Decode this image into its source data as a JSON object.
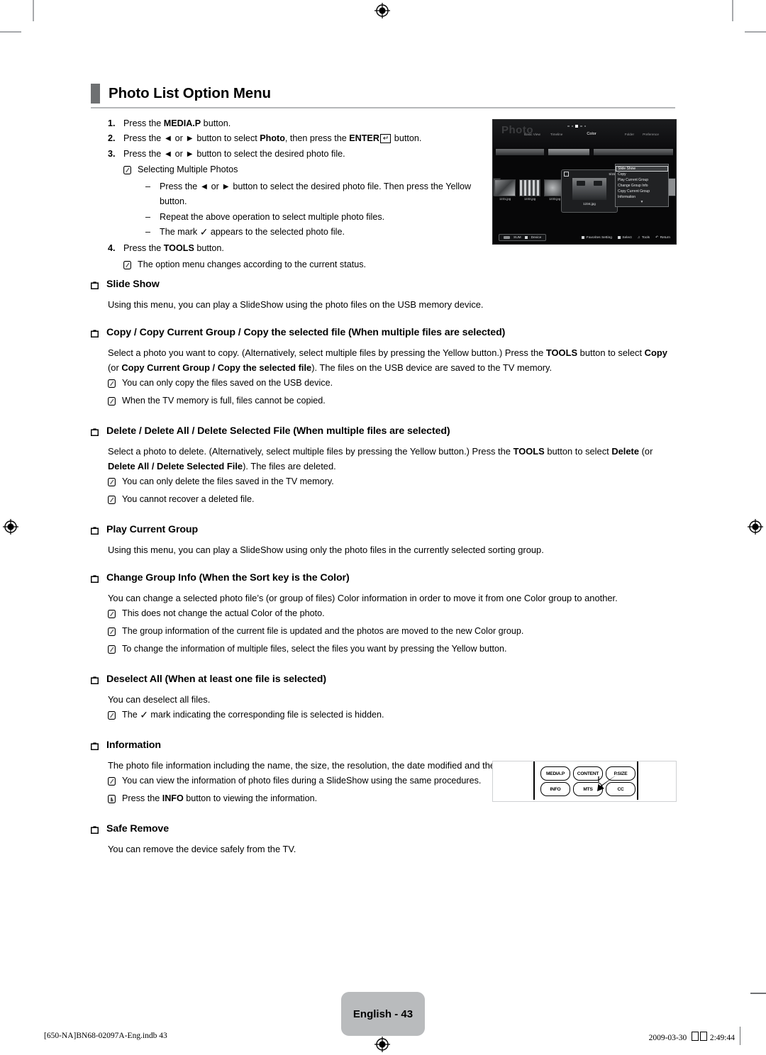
{
  "document": {
    "section_title": "Photo List Option Menu",
    "page_badge": "English - 43",
    "footer_left": "[650-NA]BN68-02097A-Eng.indb   43",
    "footer_date": "2009-03-30",
    "footer_time": "2:49:44"
  },
  "steps": [
    {
      "num": "1.",
      "pre": "Press the ",
      "bold": "MEDIA.P",
      "post": " button."
    },
    {
      "num": "2.",
      "pre": "Press the ◄ or ► button to select ",
      "bold": "Photo",
      "mid": ", then press the ",
      "bold2": "ENTER",
      "post": " button."
    },
    {
      "num": "3.",
      "pre": "Press the ◄ or ► button to select the desired photo file."
    },
    {
      "num": "4.",
      "pre": "Press the ",
      "bold": "TOOLS",
      "post": " button."
    }
  ],
  "step3_note": "Selecting Multiple Photos",
  "step3_dashes": [
    "Press the ◄ or ► button to select the desired photo file. Then press the Yellow button.",
    "Repeat the above operation to select multiple photo files.",
    "The mark ✓ appears to the selected photo file."
  ],
  "step3_dash3_a": "The mark ",
  "step3_dash3_b": " appears to the selected photo file.",
  "step4_note": "The option menu changes according to the current status.",
  "sections": [
    {
      "id": "slide-show",
      "title": "Slide Show",
      "paragraph": "Using this menu, you can play a SlideShow using the photo files on the USB memory device.",
      "notes": []
    },
    {
      "id": "copy",
      "title": "Copy / Copy Current Group / Copy the selected file (When multiple files are selected)",
      "para_parts": {
        "p1": "Select a photo you want to copy. (Alternatively, select multiple files by pressing the Yellow button.) Press the ",
        "b1": "TOOLS",
        "p2": " button to select ",
        "b2": "Copy",
        "p3": " (or ",
        "b3": "Copy Current Group / Copy the selected file",
        "p4": "). The files on the USB device are saved to the TV memory."
      },
      "notes": [
        "You can only copy the files saved on the USB device.",
        "When the TV memory is full, files cannot be copied."
      ]
    },
    {
      "id": "delete",
      "title": "Delete / Delete All / Delete Selected File (When multiple files are selected)",
      "para_parts": {
        "p1": "Select a photo to delete. (Alternatively, select multiple files by pressing the Yellow button.) Press the ",
        "b1": "TOOLS",
        "p2": " button to select ",
        "b2": "Delete",
        "p3": " (or ",
        "b3": "Delete All / Delete Selected File",
        "p4": "). The files are deleted."
      },
      "notes": [
        "You can only delete the files saved in the TV memory.",
        "You cannot recover a deleted file."
      ]
    },
    {
      "id": "play-current-group",
      "title": "Play Current Group",
      "paragraph": "Using this menu, you can play a SlideShow using only the photo files in the currently selected sorting group.",
      "notes": []
    },
    {
      "id": "change-group-info",
      "title": "Change Group Info (When the Sort key is the Color)",
      "paragraph": "You can change a selected photo file’s (or group of files) Color information in order to move it from one Color group to another.",
      "notes": [
        "This does not change the actual Color of the photo.",
        "The group information of the current file is updated and the photos are moved to the new Color group.",
        "To change the information of multiple files, select the files you want by pressing the Yellow button."
      ]
    },
    {
      "id": "deselect-all",
      "title": "Deselect All (When at least one file is selected)",
      "paragraph": "You can deselect all files.",
      "notes": []
    },
    {
      "id": "information",
      "title": "Information",
      "paragraph": "The photo file information including the name, the size, the resolution, the date modified and the path is displayed.",
      "notes": [
        "You can view the information of photo files during a SlideShow using the same procedures."
      ]
    },
    {
      "id": "safe-remove",
      "title": "Safe Remove",
      "paragraph": "You can remove the device safely from the TV.",
      "notes": []
    }
  ],
  "deselect_note": {
    "a": "The ",
    "b": " mark indicating the corresponding file is selected is hidden."
  },
  "info_button_note": {
    "a": "Press the ",
    "b": "INFO",
    "c": " button to viewing the information."
  },
  "tv_screen": {
    "heading": "Photo",
    "tabs": [
      "Basic View",
      "Timeline",
      "Color",
      "Folder",
      "Preference"
    ],
    "active_tab": "Color",
    "thumbnails": [
      {
        "name": "1231.jpg"
      },
      {
        "name": "1232.jpg"
      },
      {
        "name": "1233.jpg"
      }
    ],
    "selected": {
      "counter": "5/15",
      "name": "1234.jpg"
    },
    "option_menu": [
      "Slide Show",
      "Copy",
      "Play Current Group",
      "Change Group Info",
      "Copy Current Group",
      "Information"
    ],
    "option_menu_selected": "Slide Show",
    "option_menu_more": "▼",
    "status_left": [
      "SUM",
      "Device"
    ],
    "status_right": [
      "Favorites Setting",
      "Select",
      "Tools",
      "Return"
    ]
  },
  "remote": {
    "buttons": [
      "MEDIA.P",
      "CONTENT",
      "P.SIZE",
      "INFO",
      "MTS",
      "CC"
    ],
    "highlighted": "INFO"
  }
}
